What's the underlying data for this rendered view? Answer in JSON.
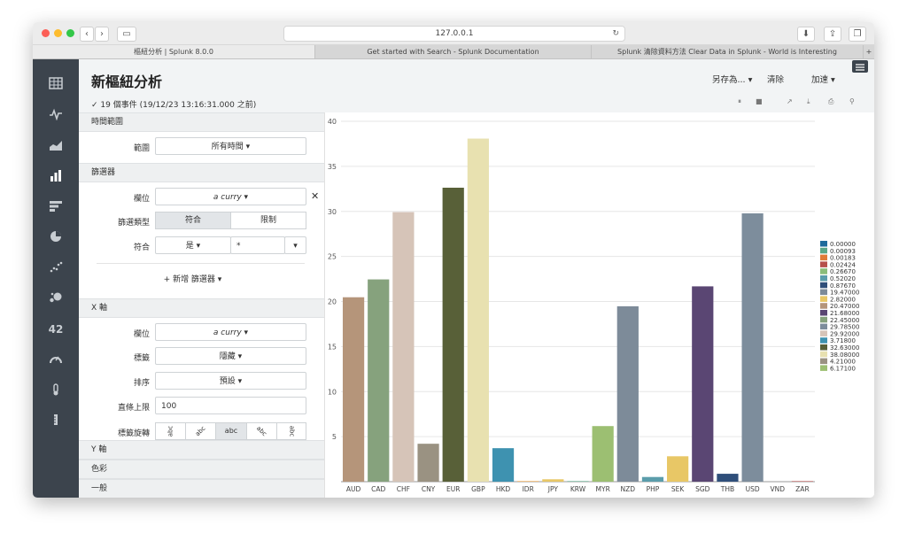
{
  "browser": {
    "url": "127.0.0.1",
    "tabs": [
      {
        "label": "樞紐分析 | Splunk 8.0.0"
      },
      {
        "label": "Get started with Search - Splunk Documentation"
      },
      {
        "label": "Splunk 清除資料方法 Clear Data in Splunk - World is Interesting"
      }
    ],
    "new_tab": "+"
  },
  "header": {
    "title": "新樞紐分析",
    "job_info": "✓ 19 個事件 (19/12/23 13:16:31.000 之前)",
    "save_as": "另存為... ▾",
    "clear": "清除",
    "accelerate": "加速 ▾",
    "mini_controls": [
      "⏸",
      "■",
      "↗",
      "⤓",
      "⎙",
      "⚲"
    ]
  },
  "sidebar_icons": [
    "table-icon",
    "line-chart-icon",
    "area-chart-icon",
    "column-chart-icon",
    "bar-chart-icon",
    "pie-chart-icon",
    "scatter-chart-icon",
    "bubble-chart-icon",
    "single-value-icon",
    "radial-gauge-icon",
    "filler-gauge-icon",
    "marker-gauge-icon"
  ],
  "single_value_glyph": "42",
  "panel": {
    "time_section": "時間範圍",
    "range_label": "範圍",
    "range_value": "所有時間 ▾",
    "filter_section": "篩選器",
    "field_label": "欄位",
    "field_value": "a curry ▾",
    "remove": "✕",
    "filter_type_label": "篩選類型",
    "filter_type_options": [
      "符合",
      "限制"
    ],
    "match_label": "符合",
    "match_op": "是 ▾",
    "match_value": "*",
    "match_caret": "▾",
    "add_filter": "+ 新增 篩選器 ▾",
    "xaxis_section": "X 軸",
    "x_field_label": "欄位",
    "x_field_value": "a curry ▾",
    "x_label_label": "標籤",
    "x_label_value": "隱藏 ▾",
    "sort_label": "排序",
    "sort_value": "預設 ▾",
    "max_bars_label": "直條上限",
    "max_bars_value": "100",
    "label_rotation_label": "標籤旋轉",
    "label_rotation_options": [
      "abc",
      "abc",
      "abc",
      "abc",
      "abc"
    ],
    "yaxis_section": "Y 軸",
    "color_section": "色彩",
    "general_section": "一般"
  },
  "chart_data": {
    "type": "bar",
    "categories": [
      "AUD",
      "CAD",
      "CHF",
      "CNY",
      "EUR",
      "GBP",
      "HKD",
      "IDR",
      "JPY",
      "KRW",
      "MYR",
      "NZD",
      "PHP",
      "SEK",
      "SGD",
      "THB",
      "USD",
      "VND",
      "ZAR"
    ],
    "values": [
      20.47,
      22.45,
      29.92,
      4.21,
      32.63,
      38.08,
      3.718,
      0.00183,
      0.2667,
      0.00093,
      6.171,
      19.47,
      0.5202,
      2.82,
      21.68,
      0.8767,
      29.785,
      0.0,
      0.02424
    ],
    "ylim": [
      0,
      40
    ],
    "yticks": [
      5,
      10,
      15,
      20,
      25,
      30,
      35,
      40
    ],
    "grid": true,
    "legend_position": "right",
    "legend": [
      "0.00000",
      "0.00093",
      "0.00183",
      "0.02424",
      "0.26670",
      "0.52020",
      "0.87670",
      "19.47000",
      "2.82000",
      "20.47000",
      "21.68000",
      "22.45000",
      "29.78500",
      "29.92000",
      "3.71800",
      "32.63000",
      "38.08000",
      "4.21000",
      "6.17100"
    ],
    "legend_colors": [
      "#1e6b9c",
      "#5aa889",
      "#e07b39",
      "#b6504c",
      "#8bbd7a",
      "#5b9dab",
      "#2f4f7a",
      "#7d8b99",
      "#e8c766",
      "#b5957a",
      "#5a4673",
      "#86a27d",
      "#7d8d9c",
      "#d6c4b8",
      "#3e92b0",
      "#586038",
      "#e8e1b0",
      "#9a9282",
      "#9cbf72"
    ],
    "bar_colors": [
      "#b5957a",
      "#86a27d",
      "#d6c4b8",
      "#9a9282",
      "#586038",
      "#e8e1b0",
      "#3e92b0",
      "#f0a03a",
      "#e8c766",
      "#5aa889",
      "#9cbf72",
      "#7d8b99",
      "#5b9dab",
      "#e8c766",
      "#5a4673",
      "#2f4f7a",
      "#7d8d9c",
      "#1e6b9c",
      "#b6504c"
    ]
  }
}
